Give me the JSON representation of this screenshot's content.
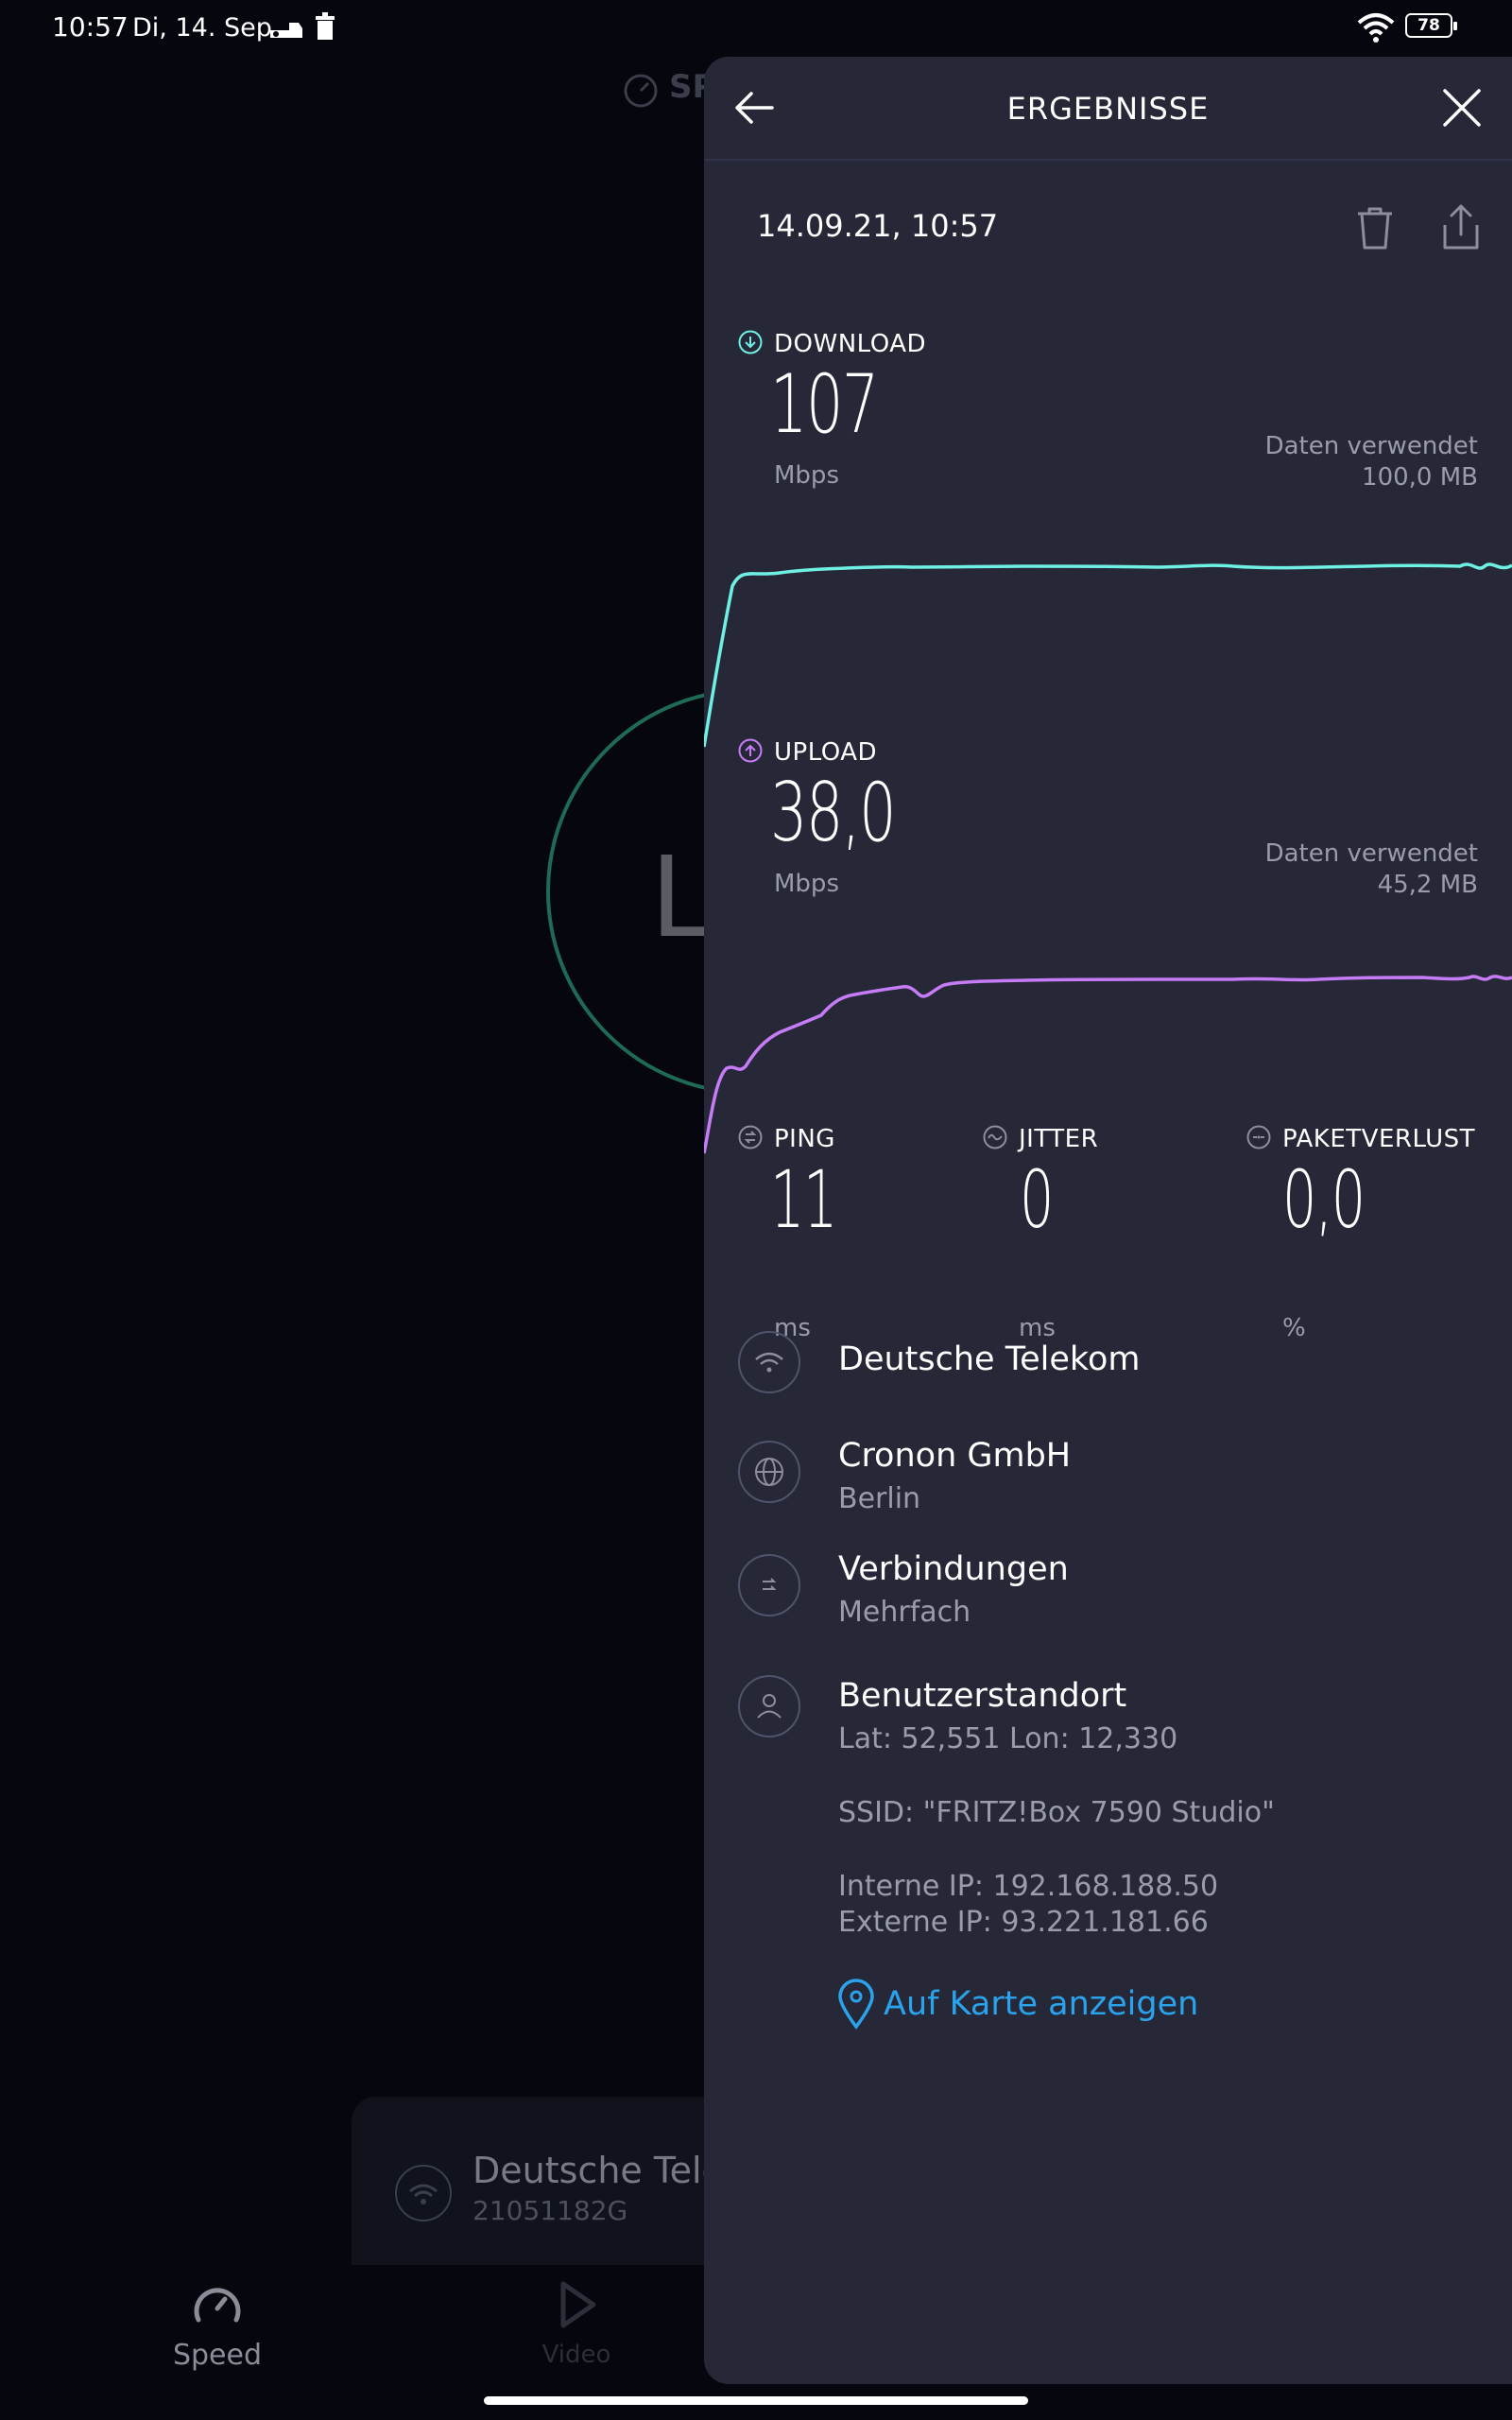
{
  "status_bar": {
    "time": "10:57",
    "date": "Di, 14. Sep",
    "battery": "78"
  },
  "background": {
    "title_partial": "SP",
    "gauge_letter": "L",
    "network_card": {
      "name": "Deutsche Tele",
      "id": "21051182G"
    },
    "nav": {
      "speed_label": "Speed",
      "video_label": "Video"
    }
  },
  "panel": {
    "title": "ERGEBNISSE",
    "date": "14.09.21, 10:57",
    "download": {
      "label": "DOWNLOAD",
      "value": "107",
      "unit": "Mbps",
      "data_used_label": "Daten verwendet",
      "data_used_value": "100,0 MB",
      "color": "#6ff0e4"
    },
    "upload": {
      "label": "UPLOAD",
      "value": "38,0",
      "unit": "Mbps",
      "data_used_label": "Daten verwendet",
      "data_used_value": "45,2 MB",
      "color": "#c77cf7"
    },
    "ping": {
      "label": "PING",
      "value": "11",
      "unit": "ms"
    },
    "jitter": {
      "label": "JITTER",
      "value": "0",
      "unit": "ms"
    },
    "packet_loss": {
      "label": "PAKETVERLUST",
      "value": "0,0",
      "unit": "%"
    },
    "provider": {
      "name": "Deutsche Telekom"
    },
    "server": {
      "name": "Cronon GmbH",
      "city": "Berlin"
    },
    "connections": {
      "label": "Verbindungen",
      "value": "Mehrfach"
    },
    "location": {
      "label": "Benutzerstandort",
      "coords": "Lat: 52,551 Lon: 12,330",
      "ssid": "SSID: \"FRITZ!Box 7590 Studio\"",
      "internal_ip": "Interne IP: 192.168.188.50",
      "external_ip": "Externe IP: 93.221.181.66"
    },
    "map_link": "Auf Karte anzeigen",
    "link_color": "#2aa3ec"
  }
}
